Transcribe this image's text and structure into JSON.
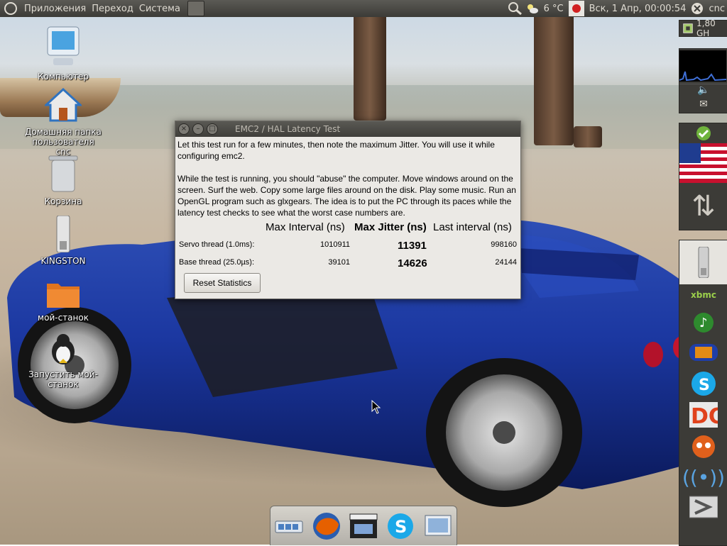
{
  "top_panel": {
    "menus": [
      "Приложения",
      "Переход",
      "Система"
    ],
    "weather": "6 °C",
    "datetime": "Вск, 1 Апр, 00:00:54",
    "user": "cnc"
  },
  "side_panel": {
    "cpu_freq": "1,80 GH"
  },
  "desktop_icons": [
    {
      "label": "Компьютер",
      "icon": "computer-icon"
    },
    {
      "label": "Домашняя папка пользователя cnc",
      "icon": "home-folder-icon"
    },
    {
      "label": "Корзина",
      "icon": "trash-icon"
    },
    {
      "label": "KINGSTON",
      "icon": "usb-drive-icon"
    },
    {
      "label": "мой-станок",
      "icon": "folder-link-icon"
    },
    {
      "label": "Запустить мой-станок",
      "icon": "linuxcnc-launcher-icon"
    }
  ],
  "window": {
    "title": "EMC2 / HAL Latency Test",
    "intro": "Let this test run for a few minutes, then note the maximum Jitter.  You will use it while configuring emc2.",
    "instructions": "While the test is running, you should \"abuse\" the computer. Move windows around on the screen. Surf the web. Copy some large files around on the disk. Play some music. Run an OpenGL program such as glxgears. The idea is to put the PC through its paces while the latency test checks to see what the worst case numbers are.",
    "headers": {
      "max_interval": "Max Interval (ns)",
      "max_jitter": "Max Jitter (ns)",
      "last_interval": "Last interval (ns)"
    },
    "rows": [
      {
        "label": "Servo thread (1.0ms):",
        "max_interval": "1010911",
        "max_jitter": "11391",
        "last_interval": "998160"
      },
      {
        "label": "Base thread (25.0µs):",
        "max_interval": "39101",
        "max_jitter": "14626",
        "last_interval": "24144"
      }
    ],
    "reset_label": "Reset Statistics"
  },
  "dock_items": [
    "panel-switcher-icon",
    "firefox-icon",
    "video-editor-icon",
    "skype-icon",
    "desktop-icon"
  ],
  "side_launchers": [
    "usb-drive-icon",
    "xbmc-icon",
    "music-player-icon",
    "audio-recorder-icon",
    "skype-icon",
    "doc-viewer-icon",
    "panda-icon",
    "wireless-icon",
    "exit-icon"
  ]
}
